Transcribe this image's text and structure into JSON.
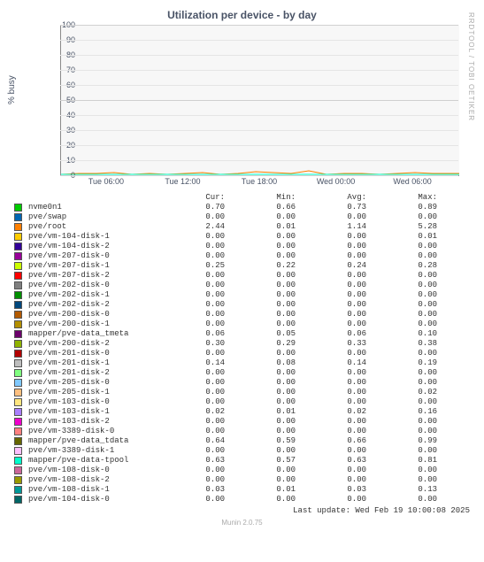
{
  "title": "Utilization per device - by day",
  "ylabel": "% busy",
  "rrd_credit": "RRDTOOL / TOBI OETIKER",
  "munin_credit": "Munin 2.0.75",
  "last_update": "Last update: Wed Feb 19 10:00:08 2025",
  "y_ticks": [
    0,
    10,
    20,
    30,
    40,
    50,
    60,
    70,
    80,
    90,
    100
  ],
  "x_ticks": [
    "Tue 06:00",
    "Tue 12:00",
    "Tue 18:00",
    "Wed 00:00",
    "Wed 06:00"
  ],
  "columns": [
    "Cur:",
    "Min:",
    "Avg:",
    "Max:"
  ],
  "chart_data": {
    "type": "line",
    "x_categories": [
      "Tue 06:00",
      "Tue 12:00",
      "Tue 18:00",
      "Wed 00:00",
      "Wed 06:00"
    ],
    "ylim": [
      0,
      100
    ],
    "ylabel": "% busy",
    "title": "Utilization per device - by day",
    "series": [
      {
        "name": "nvme0n1",
        "color": "#00cc00",
        "cur": 0.7,
        "min": 0.66,
        "avg": 0.73,
        "max": 0.89
      },
      {
        "name": "pve/swap",
        "color": "#0066b3",
        "cur": 0.0,
        "min": 0.0,
        "avg": 0.0,
        "max": 0.0
      },
      {
        "name": "pve/root",
        "color": "#ff8000",
        "cur": 2.44,
        "min": 0.01,
        "avg": 1.14,
        "max": 5.28
      },
      {
        "name": "pve/vm-104-disk-1",
        "color": "#ffcc00",
        "cur": 0.0,
        "min": 0.0,
        "avg": 0.0,
        "max": 0.01
      },
      {
        "name": "pve/vm-104-disk-2",
        "color": "#330099",
        "cur": 0.0,
        "min": 0.0,
        "avg": 0.0,
        "max": 0.0
      },
      {
        "name": "pve/vm-207-disk-0",
        "color": "#990099",
        "cur": 0.0,
        "min": 0.0,
        "avg": 0.0,
        "max": 0.0
      },
      {
        "name": "pve/vm-207-disk-1",
        "color": "#ccff00",
        "cur": 0.25,
        "min": 0.22,
        "avg": 0.24,
        "max": 0.28
      },
      {
        "name": "pve/vm-207-disk-2",
        "color": "#ff0000",
        "cur": 0.0,
        "min": 0.0,
        "avg": 0.0,
        "max": 0.0
      },
      {
        "name": "pve/vm-202-disk-0",
        "color": "#808080",
        "cur": 0.0,
        "min": 0.0,
        "avg": 0.0,
        "max": 0.0
      },
      {
        "name": "pve/vm-202-disk-1",
        "color": "#008f00",
        "cur": 0.0,
        "min": 0.0,
        "avg": 0.0,
        "max": 0.0
      },
      {
        "name": "pve/vm-202-disk-2",
        "color": "#00487d",
        "cur": 0.0,
        "min": 0.0,
        "avg": 0.0,
        "max": 0.0
      },
      {
        "name": "pve/vm-200-disk-0",
        "color": "#b35a00",
        "cur": 0.0,
        "min": 0.0,
        "avg": 0.0,
        "max": 0.0
      },
      {
        "name": "pve/vm-200-disk-1",
        "color": "#b38f00",
        "cur": 0.0,
        "min": 0.0,
        "avg": 0.0,
        "max": 0.0
      },
      {
        "name": "mapper/pve-data_tmeta",
        "color": "#6b006b",
        "cur": 0.06,
        "min": 0.05,
        "avg": 0.06,
        "max": 0.1
      },
      {
        "name": "pve/vm-200-disk-2",
        "color": "#8fb300",
        "cur": 0.3,
        "min": 0.29,
        "avg": 0.33,
        "max": 0.38
      },
      {
        "name": "pve/vm-201-disk-0",
        "color": "#b30000",
        "cur": 0.0,
        "min": 0.0,
        "avg": 0.0,
        "max": 0.0
      },
      {
        "name": "pve/vm-201-disk-1",
        "color": "#bebebe",
        "cur": 0.14,
        "min": 0.08,
        "avg": 0.14,
        "max": 0.19
      },
      {
        "name": "pve/vm-201-disk-2",
        "color": "#80ff80",
        "cur": 0.0,
        "min": 0.0,
        "avg": 0.0,
        "max": 0.0
      },
      {
        "name": "pve/vm-205-disk-0",
        "color": "#80c9ff",
        "cur": 0.0,
        "min": 0.0,
        "avg": 0.0,
        "max": 0.0
      },
      {
        "name": "pve/vm-205-disk-1",
        "color": "#ffc080",
        "cur": 0.0,
        "min": 0.0,
        "avg": 0.0,
        "max": 0.02
      },
      {
        "name": "pve/vm-103-disk-0",
        "color": "#ffe680",
        "cur": 0.0,
        "min": 0.0,
        "avg": 0.0,
        "max": 0.0
      },
      {
        "name": "pve/vm-103-disk-1",
        "color": "#aa80ff",
        "cur": 0.02,
        "min": 0.01,
        "avg": 0.02,
        "max": 0.16
      },
      {
        "name": "pve/vm-103-disk-2",
        "color": "#ee00cc",
        "cur": 0.0,
        "min": 0.0,
        "avg": 0.0,
        "max": 0.0
      },
      {
        "name": "pve/vm-3389-disk-0",
        "color": "#ff8080",
        "cur": 0.0,
        "min": 0.0,
        "avg": 0.0,
        "max": 0.0
      },
      {
        "name": "mapper/pve-data_tdata",
        "color": "#666600",
        "cur": 0.64,
        "min": 0.59,
        "avg": 0.66,
        "max": 0.99
      },
      {
        "name": "pve/vm-3389-disk-1",
        "color": "#ffbfff",
        "cur": 0.0,
        "min": 0.0,
        "avg": 0.0,
        "max": 0.0
      },
      {
        "name": "mapper/pve-data-tpool",
        "color": "#00ffcc",
        "cur": 0.63,
        "min": 0.57,
        "avg": 0.63,
        "max": 0.81
      },
      {
        "name": "pve/vm-108-disk-0",
        "color": "#cc6699",
        "cur": 0.0,
        "min": 0.0,
        "avg": 0.0,
        "max": 0.0
      },
      {
        "name": "pve/vm-108-disk-2",
        "color": "#999900",
        "cur": 0.0,
        "min": 0.0,
        "avg": 0.0,
        "max": 0.0
      },
      {
        "name": "pve/vm-108-disk-1",
        "color": "#009999",
        "cur": 0.03,
        "min": 0.01,
        "avg": 0.03,
        "max": 0.13
      },
      {
        "name": "pve/vm-104-disk-0",
        "color": "#006666",
        "cur": 0.0,
        "min": 0.0,
        "avg": 0.0,
        "max": 0.0
      }
    ]
  }
}
